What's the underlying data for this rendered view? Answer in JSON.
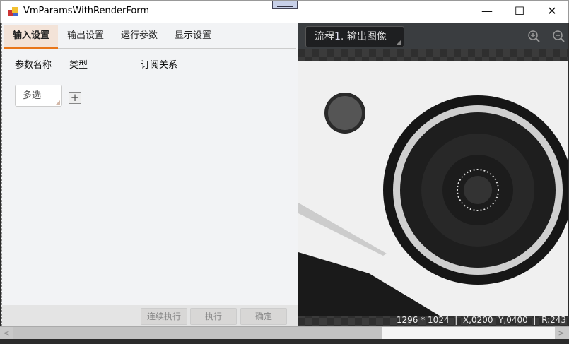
{
  "window": {
    "title": "VmParamsWithRenderForm",
    "minimize": "—",
    "maximize": "☐",
    "close": "✕"
  },
  "tabs": [
    {
      "label": "输入设置",
      "active": true
    },
    {
      "label": "输出设置"
    },
    {
      "label": "运行参数"
    },
    {
      "label": "显示设置"
    }
  ],
  "columns": [
    "参数名称",
    "类型",
    "订阅关系"
  ],
  "multi_select": "多选",
  "add_button": "+",
  "footer_buttons": [
    "连续执行",
    "执行",
    "确定"
  ],
  "render": {
    "source_prefix": "流程",
    "source_number": "1",
    "source_suffix": ". 输出图像",
    "status": "1296 * 1024  |  X,0200  Y,0400  |  R:243"
  },
  "scroll": {
    "left": "<",
    "right": ">"
  }
}
